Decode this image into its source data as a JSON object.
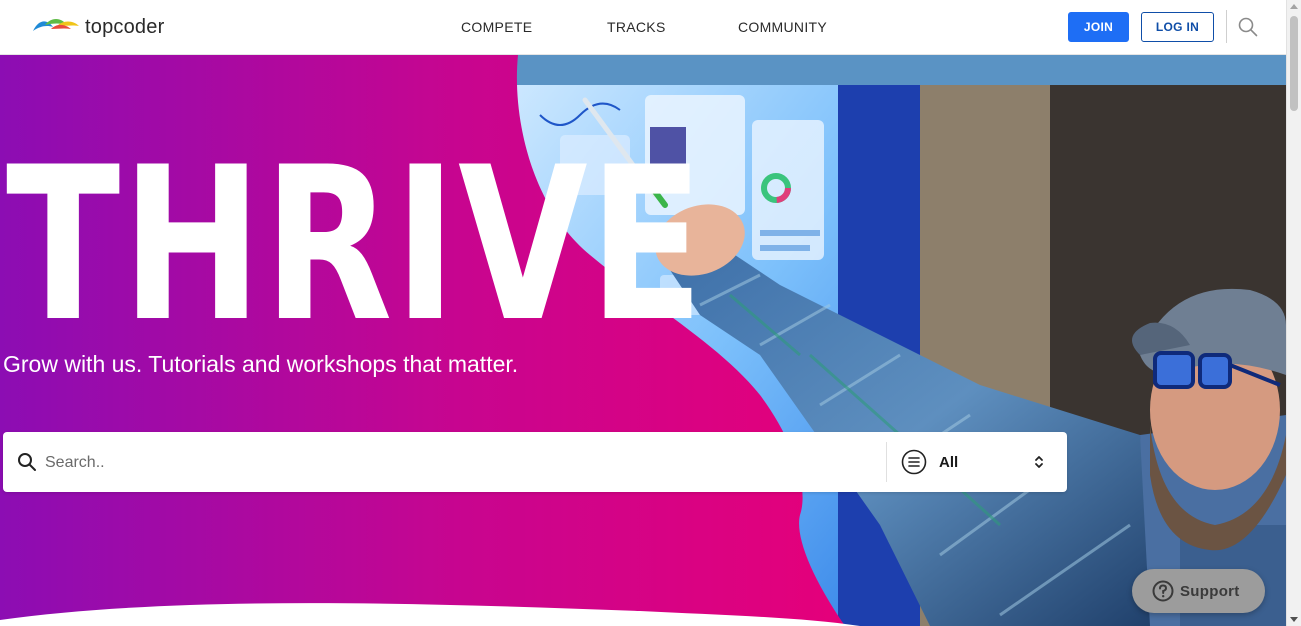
{
  "header": {
    "logo_text": "topcoder",
    "nav": [
      {
        "label": "COMPETE"
      },
      {
        "label": "TRACKS"
      },
      {
        "label": "COMMUNITY"
      }
    ],
    "join_label": "JOIN",
    "login_label": "LOG IN",
    "search_icon": "search-icon"
  },
  "hero": {
    "title": "THRIVE",
    "subtitle": "Grow with us. Tutorials and workshops that matter.",
    "search": {
      "placeholder": "Search..",
      "value": "",
      "filter_icon": "list-icon",
      "filter_selected": "All",
      "chevron_icon": "chevron-up-down-icon"
    }
  },
  "support": {
    "label": "Support",
    "icon": "question-circle-icon"
  },
  "colors": {
    "brand_blue": "#1e6ef5",
    "login_border": "#0f4ea8",
    "hero_purple": "#8a0fb0",
    "hero_magenta": "#e2007a"
  }
}
